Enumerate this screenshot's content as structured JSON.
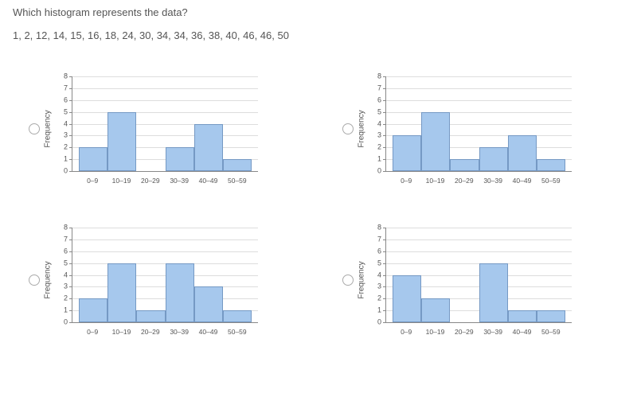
{
  "question": "Which histogram represents the data?",
  "data_list": "1, 2, 12, 14, 15, 16, 18, 24, 30, 34, 34, 36, 38, 40, 46, 46, 50",
  "ylabel": "Frequency",
  "y_ticks": [
    0,
    1,
    2,
    3,
    4,
    5,
    6,
    7,
    8
  ],
  "x_categories": [
    "0–9",
    "10–19",
    "20–29",
    "30–39",
    "40–49",
    "50–59"
  ],
  "chart_data": [
    {
      "type": "bar",
      "categories": [
        "0–9",
        "10–19",
        "20–29",
        "30–39",
        "40–49",
        "50–59"
      ],
      "values": [
        2,
        5,
        0,
        2,
        4,
        1
      ],
      "ylabel": "Frequency",
      "ylim": [
        0,
        8
      ]
    },
    {
      "type": "bar",
      "categories": [
        "0–9",
        "10–19",
        "20–29",
        "30–39",
        "40–49",
        "50–59"
      ],
      "values": [
        3,
        5,
        1,
        2,
        3,
        1
      ],
      "ylabel": "Frequency",
      "ylim": [
        0,
        8
      ]
    },
    {
      "type": "bar",
      "categories": [
        "0–9",
        "10–19",
        "20–29",
        "30–39",
        "40–49",
        "50–59"
      ],
      "values": [
        2,
        5,
        1,
        5,
        3,
        1
      ],
      "ylabel": "Frequency",
      "ylim": [
        0,
        8
      ]
    },
    {
      "type": "bar",
      "categories": [
        "0–9",
        "10–19",
        "20–29",
        "30–39",
        "40–49",
        "50–59"
      ],
      "values": [
        4,
        2,
        0,
        5,
        1,
        1
      ],
      "ylabel": "Frequency",
      "ylim": [
        0,
        8
      ]
    }
  ]
}
